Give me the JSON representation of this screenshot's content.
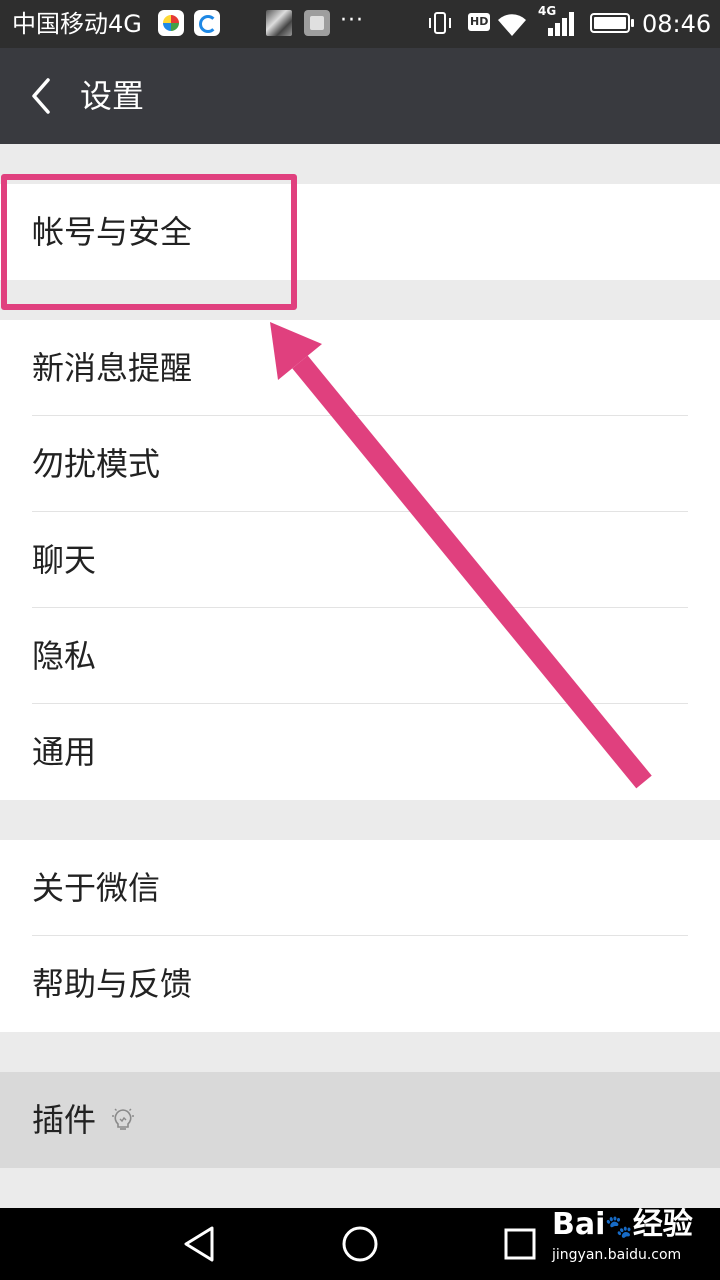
{
  "status_bar": {
    "carrier": "中国移动4G",
    "more": "···",
    "hd": "HD",
    "network": "4G",
    "time": "08:46"
  },
  "header": {
    "title": "设置"
  },
  "groups": [
    {
      "items": [
        {
          "label": "帐号与安全"
        }
      ]
    },
    {
      "items": [
        {
          "label": "新消息提醒"
        },
        {
          "label": "勿扰模式"
        },
        {
          "label": "聊天"
        },
        {
          "label": "隐私"
        },
        {
          "label": "通用"
        }
      ]
    },
    {
      "items": [
        {
          "label": "关于微信"
        },
        {
          "label": "帮助与反馈"
        }
      ]
    },
    {
      "items": [
        {
          "label": "插件"
        }
      ]
    }
  ],
  "annotation": {
    "color": "#e0407e"
  },
  "watermark": {
    "brand": "Bai",
    "brand_suffix": "经验",
    "url": "jingyan.baidu.com"
  },
  "colors": {
    "status_bar_bg": "#2e2e2e",
    "title_bar_bg": "#393a3f",
    "page_bg": "#ebebeb",
    "accent_annotation": "#e0407e"
  }
}
